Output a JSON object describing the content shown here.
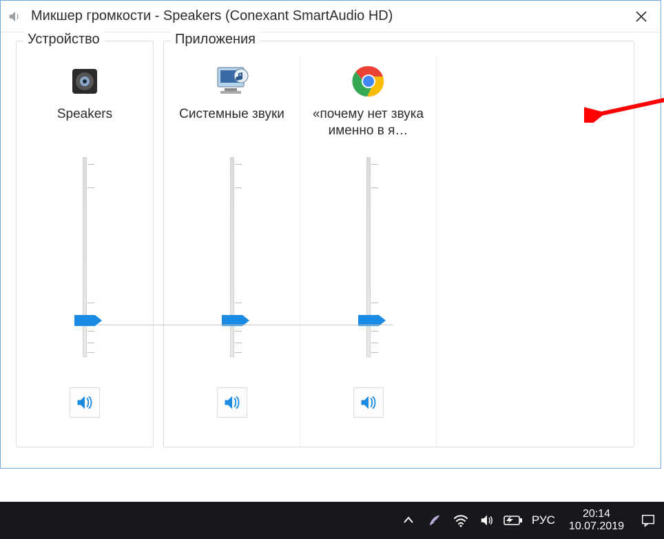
{
  "window": {
    "title": "Микшер громкости - Speakers (Conexant SmartAudio HD)"
  },
  "sections": {
    "device_label": "Устройство",
    "apps_label": "Приложения"
  },
  "channels": {
    "device": {
      "name": "Speakers",
      "level": 20,
      "icon": "speaker-device"
    },
    "apps": [
      {
        "name": "Системные звуки",
        "level": 20,
        "icon": "system-sounds"
      },
      {
        "name": "«почему нет звука именно в я…",
        "level": 20,
        "icon": "chrome"
      }
    ]
  },
  "taskbar": {
    "lang": "РУС",
    "time": "20:14",
    "date": "10.07.2019"
  }
}
